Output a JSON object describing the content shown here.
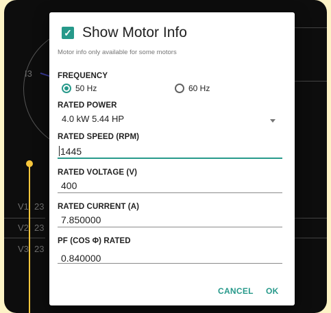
{
  "background": {
    "circle_label": "I3",
    "rows": [
      {
        "label": "V1",
        "value": "23"
      },
      {
        "label": "V2",
        "value": "23"
      },
      {
        "label": "V3",
        "value": "23"
      }
    ]
  },
  "dialog": {
    "title": "Show Motor Info",
    "checked": true,
    "subtitle": "Motor info only available for some motors",
    "frequency": {
      "label": "FREQUENCY",
      "options": [
        "50 Hz",
        "60 Hz"
      ],
      "selected": "50 Hz"
    },
    "rated_power": {
      "label": "RATED POWER",
      "value": "4.0 kW 5.44 HP"
    },
    "rated_speed": {
      "label": "RATED SPEED (RPM)",
      "value": "1445"
    },
    "rated_voltage": {
      "label": "RATED VOLTAGE (V)",
      "value": "400"
    },
    "rated_current": {
      "label": "RATED CURRENT (A)",
      "value": "7.850000"
    },
    "pf_rated": {
      "label": "PF (COS Φ) RATED",
      "value": "0.840000"
    },
    "actions": {
      "cancel": "CANCEL",
      "ok": "OK"
    }
  },
  "colors": {
    "accent": "#26998a",
    "page_background": "#fdf3c6",
    "callout": "#f7c63c"
  },
  "icons": {
    "checkbox": "check-icon",
    "dropdown": "dropdown-arrow-icon"
  }
}
